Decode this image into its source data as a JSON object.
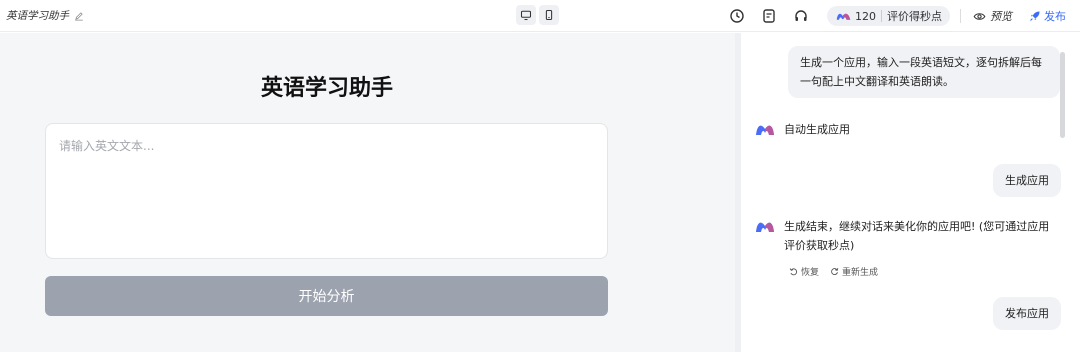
{
  "header": {
    "app_title": "英语学习助手",
    "credits": "120",
    "credits_label": "评价得秒点",
    "preview_label": "预览",
    "publish_label": "发布",
    "accent": "#3b6cf6"
  },
  "icons": [
    "edit-icon",
    "desktop-icon",
    "mobile-icon",
    "history-icon",
    "document-icon",
    "headset-icon",
    "eye-icon",
    "rocket-icon"
  ],
  "preview": {
    "title": "英语学习助手",
    "input_placeholder": "请输入英文文本...",
    "analyze_button": "开始分析",
    "button_color": "#9ca3af"
  },
  "chat": {
    "messages": [
      {
        "role": "user",
        "text": "生成一个应用，输入一段英语短文，逐句拆解后每一句配上中文翻译和英语朗读。"
      },
      {
        "role": "bot",
        "text": "自动生成应用"
      },
      {
        "role": "user",
        "text": "生成应用"
      },
      {
        "role": "bot",
        "text": "生成结束，继续对话来美化你的应用吧! (您可通过应用评价获取秒点)"
      },
      {
        "role": "user",
        "text": "发布应用"
      }
    ],
    "actions": {
      "restore": "恢复",
      "regenerate": "重新生成"
    }
  }
}
